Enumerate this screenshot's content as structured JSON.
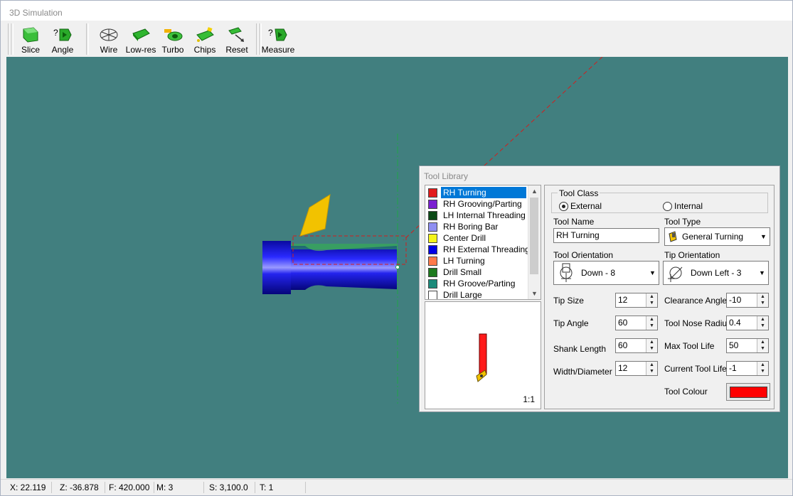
{
  "window": {
    "title": "3D Simulation"
  },
  "toolbar": {
    "buttons": [
      {
        "label": "Slice",
        "icon": "slice-icon"
      },
      {
        "label": "Angle",
        "icon": "angle-icon"
      },
      {
        "label": "Wire",
        "icon": "wire-icon"
      },
      {
        "label": "Low-res",
        "icon": "low-res-icon"
      },
      {
        "label": "Turbo",
        "icon": "turbo-icon"
      },
      {
        "label": "Chips",
        "icon": "chips-icon"
      },
      {
        "label": "Reset",
        "icon": "reset-icon"
      },
      {
        "label": "Measure",
        "icon": "measure-icon"
      }
    ]
  },
  "status": {
    "x": "X:  22.119",
    "z": "Z:  -36.878",
    "f": "F:  420.000",
    "m": "M:  3",
    "s": "S:  3,100.0",
    "t": "T:  1"
  },
  "tool_library": {
    "title": "Tool Library",
    "tools": [
      {
        "name": "RH Turning",
        "color": "#e21b1b",
        "selected": true
      },
      {
        "name": "RH Grooving/Parting",
        "color": "#7a1fd1"
      },
      {
        "name": "LH Internal Threading",
        "color": "#0b4a16"
      },
      {
        "name": "RH Boring Bar",
        "color": "#8f8ff2"
      },
      {
        "name": "Center Drill",
        "color": "#f5f51a"
      },
      {
        "name": "RH External Threading",
        "color": "#0000e6"
      },
      {
        "name": "LH Turning",
        "color": "#ff7a4a"
      },
      {
        "name": "Drill Small",
        "color": "#1e7a1e"
      },
      {
        "name": "RH Groove/Parting",
        "color": "#1c8a7a"
      },
      {
        "name": "Drill Large",
        "color": "#ffffff"
      }
    ],
    "preview_scale": "1:1",
    "tool_class_label": "Tool Class",
    "class_external": "External",
    "class_internal": "Internal",
    "tool_class_selected": "External",
    "tool_name_label": "Tool Name",
    "tool_name_value": "RH Turning",
    "tool_type_label": "Tool Type",
    "tool_type_value": "General Turning",
    "tool_orientation_label": "Tool Orientation",
    "tool_orientation_value": "Down - 8",
    "tip_orientation_label": "Tip Orientation",
    "tip_orientation_value": "Down Left - 3",
    "tip_size_label": "Tip Size",
    "tip_size_value": "12",
    "clearance_angle_label": "Clearance Angle",
    "clearance_angle_value": "-10",
    "tip_angle_label": "Tip Angle",
    "tip_angle_value": "60",
    "nose_radius_label": "Tool Nose Radius",
    "nose_radius_value": "0.4",
    "shank_length_label": "Shank Length",
    "shank_length_value": "60",
    "max_life_label": "Max Tool Life",
    "max_life_value": "50",
    "width_label": "Width/Diameter",
    "width_value": "12",
    "current_life_label": "Current Tool Life",
    "current_life_value": "-1",
    "colour_label": "Tool Colour",
    "colour_value": "#ff0000"
  },
  "colors": {
    "viewport_bg": "#417f7f",
    "workpiece": "#1818d8",
    "insert": "#f2c200",
    "selection": "#0078d7"
  }
}
